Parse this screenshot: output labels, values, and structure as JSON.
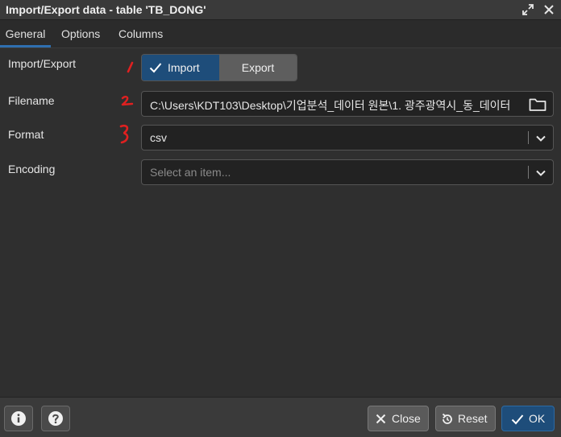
{
  "window": {
    "title": "Import/Export data - table 'TB_DONG'"
  },
  "tabs": [
    {
      "label": "General"
    },
    {
      "label": "Options"
    },
    {
      "label": "Columns"
    }
  ],
  "form": {
    "import_export": {
      "label": "Import/Export",
      "options": [
        "Import",
        "Export"
      ],
      "selected": "Import"
    },
    "filename": {
      "label": "Filename",
      "value": "C:\\Users\\KDT103\\Desktop\\기업분석_데이터 원본\\1. 광주광역시_동_데이터"
    },
    "format": {
      "label": "Format",
      "value": "csv"
    },
    "encoding": {
      "label": "Encoding",
      "placeholder": "Select an item..."
    }
  },
  "annotations": {
    "color": "#e02020"
  },
  "footer": {
    "close_label": "Close",
    "reset_label": "Reset",
    "ok_label": "OK"
  },
  "colors": {
    "accent": "#1e4d7a",
    "background": "#2f2f2f"
  }
}
